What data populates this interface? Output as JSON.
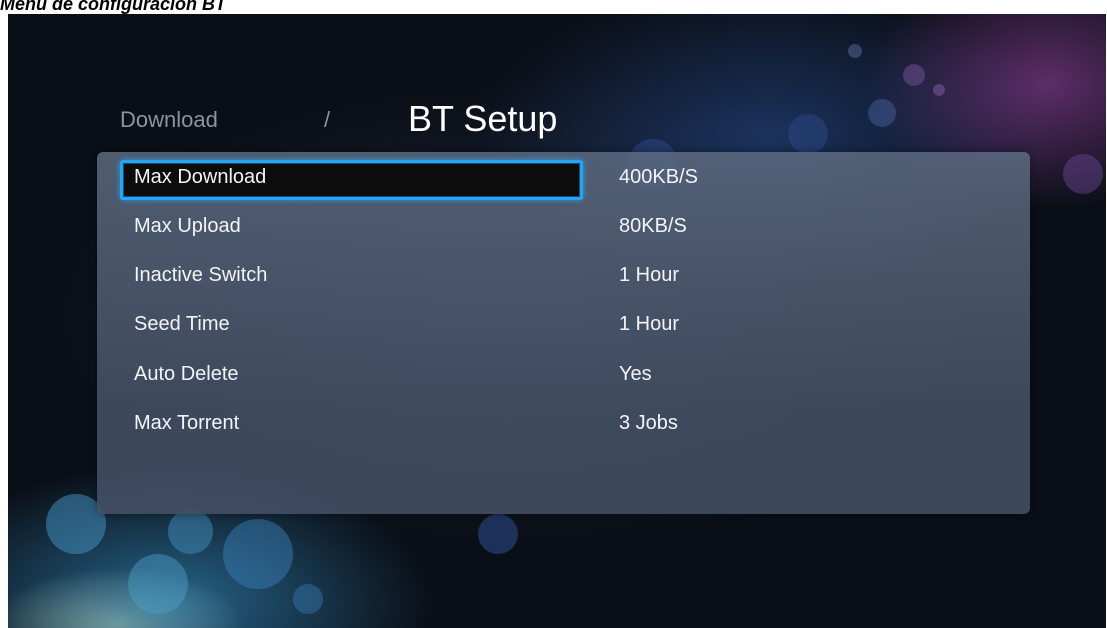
{
  "document": {
    "caption": "Menú de configuración BT"
  },
  "header": {
    "breadcrumb": "Download",
    "separator": "/",
    "title": "BT Setup"
  },
  "settings": {
    "focused_index": 0,
    "items": [
      {
        "label": "Max Download",
        "value": "400KB/S"
      },
      {
        "label": "Max Upload",
        "value": "80KB/S"
      },
      {
        "label": "Inactive Switch",
        "value": "1 Hour"
      },
      {
        "label": "Seed Time",
        "value": "1 Hour"
      },
      {
        "label": "Auto Delete",
        "value": "Yes"
      },
      {
        "label": "Max Torrent",
        "value": "3 Jobs"
      }
    ]
  },
  "colors": {
    "focus_border": "#2aa3ee",
    "panel": "#5c6a80",
    "text": "#f2f4f7",
    "breadcrumb": "#8e949d"
  }
}
